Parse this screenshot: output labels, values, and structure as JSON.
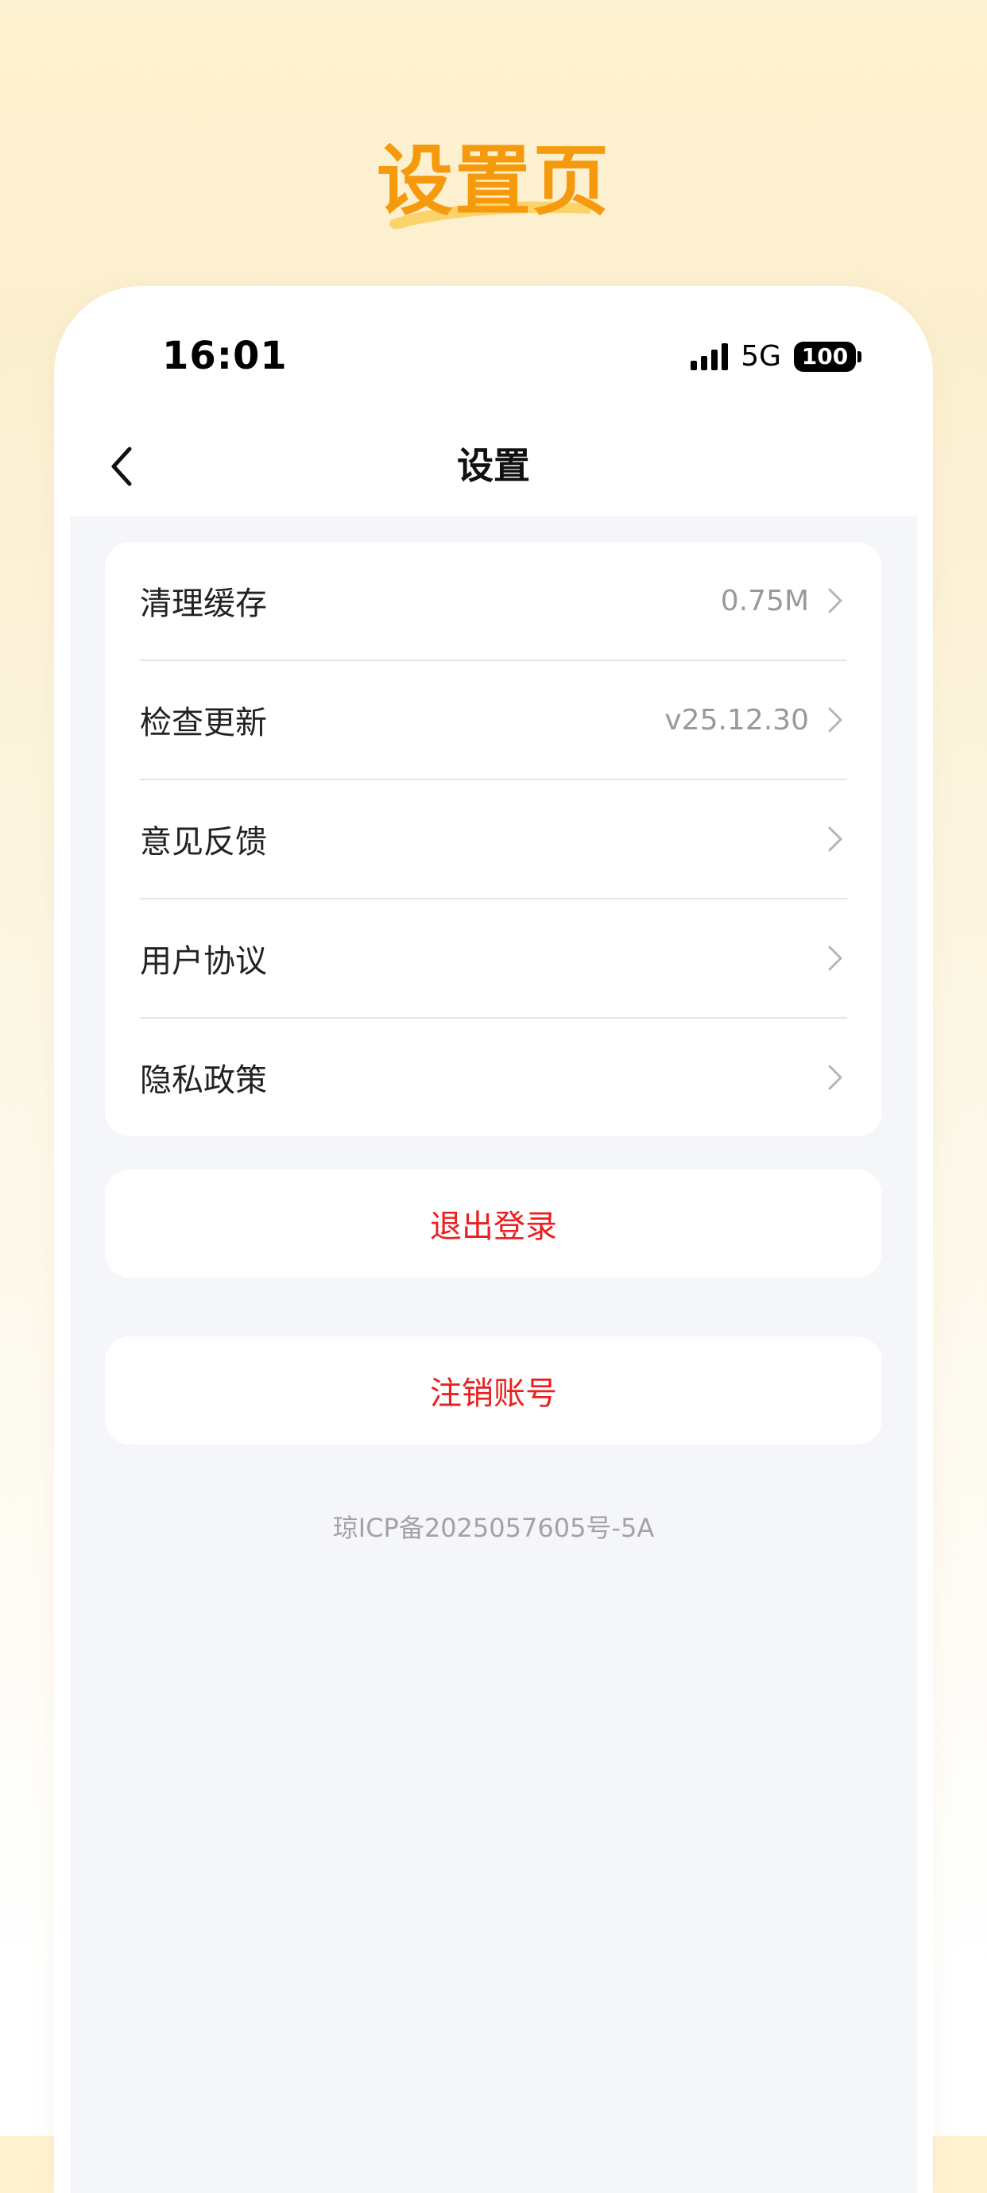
{
  "promo": {
    "title": "设置页"
  },
  "status_bar": {
    "time": "16:01",
    "network": "5G",
    "battery": "100"
  },
  "nav": {
    "title": "设置",
    "back_icon": "chevron-left-icon"
  },
  "settings_items": [
    {
      "label": "清理缓存",
      "value": "0.75M"
    },
    {
      "label": "检查更新",
      "value": "v25.12.30"
    },
    {
      "label": "意见反馈",
      "value": ""
    },
    {
      "label": "用户协议",
      "value": ""
    },
    {
      "label": "隐私政策",
      "value": ""
    }
  ],
  "actions": {
    "logout": "退出登录",
    "delete_account": "注销账号"
  },
  "footer": {
    "icp": "琼ICP备2025057605号-5A"
  },
  "colors": {
    "promo_title": "#f59a0d",
    "danger": "#ee1e1e",
    "page_bg": "#f5f6fa"
  }
}
